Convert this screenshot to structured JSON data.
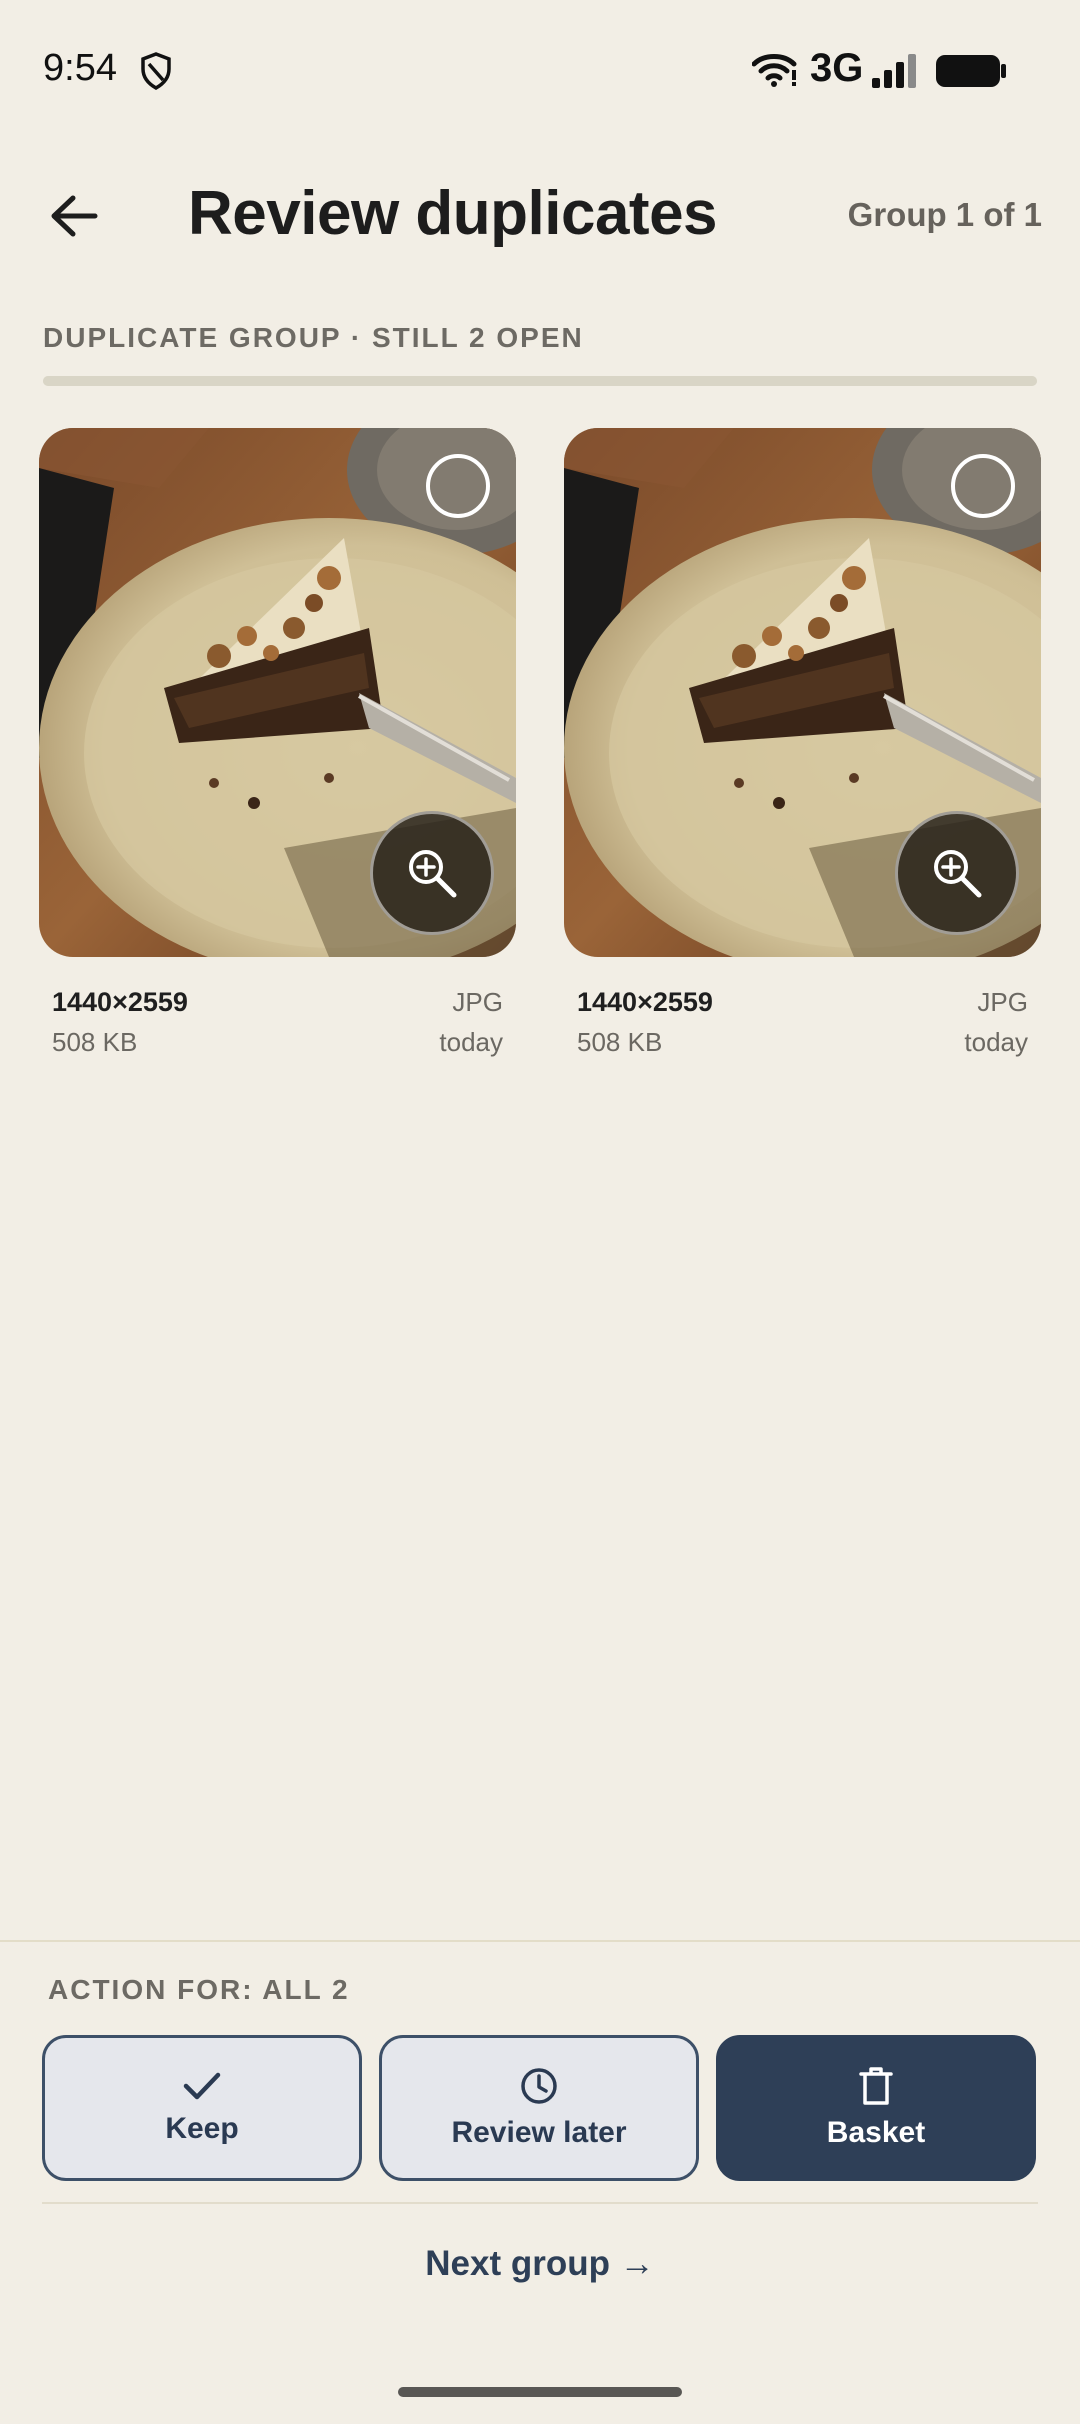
{
  "status_bar": {
    "time": "9:54",
    "network": "3G",
    "icons": [
      "shield-icon",
      "wifi-icon",
      "signal-icon",
      "battery-icon"
    ]
  },
  "header": {
    "title": "Review duplicates",
    "group_counter": "Group 1 of 1",
    "back_icon": "arrow-left-icon"
  },
  "group": {
    "label": "DUPLICATE GROUP · STILL 2 OPEN",
    "progress": 1.0,
    "photos": [
      {
        "dims": "1440×2559",
        "size": "508 KB",
        "format": "JPG",
        "date": "today",
        "selected": false
      },
      {
        "dims": "1440×2559",
        "size": "508 KB",
        "format": "JPG",
        "date": "today",
        "selected": false
      }
    ]
  },
  "actions": {
    "label": "ACTION FOR: ALL 2",
    "keep": "Keep",
    "review_later": "Review later",
    "basket": "Basket",
    "next_group": "Next group →"
  },
  "colors": {
    "background": "#f2eee5",
    "accent": "#2e3f57",
    "secondary_button_bg": "#e5e7ec"
  }
}
